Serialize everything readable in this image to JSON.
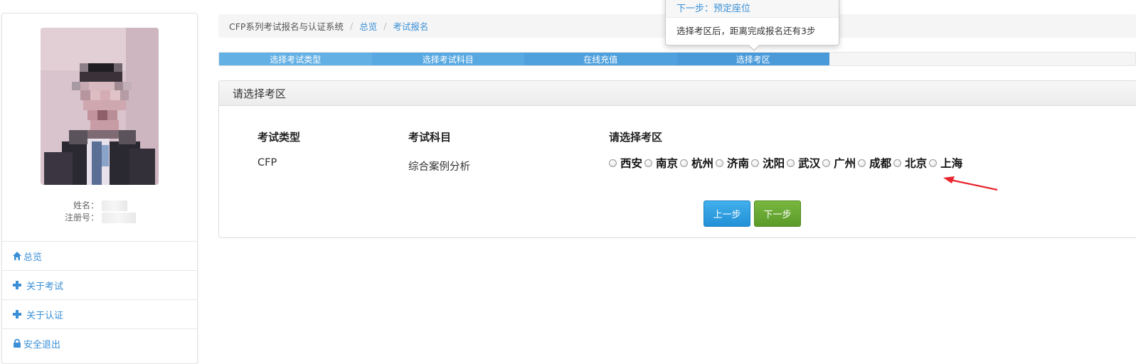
{
  "sidebar": {
    "name_label": "姓名：",
    "reg_label": "注册号：",
    "nav": [
      {
        "label": "总览",
        "icon": "home-icon"
      },
      {
        "label": "关于考试",
        "icon": "plus-icon"
      },
      {
        "label": "关于认证",
        "icon": "plus-icon"
      },
      {
        "label": "安全退出",
        "icon": "lock-icon"
      }
    ]
  },
  "breadcrumb": {
    "home": "CFP系列考试报名与认证系统",
    "sep": "/",
    "items": [
      "总览",
      "考试报名"
    ]
  },
  "progress": {
    "steps": [
      "选择考试类型",
      "选择考试科目",
      "在线充值",
      "选择考区"
    ],
    "completed_steps": 4,
    "total_fraction": 0.665
  },
  "popover": {
    "title": "下一步：预定座位",
    "body": "选择考区后，距离完成报名还有3步"
  },
  "panel": {
    "heading": "请选择考区",
    "columns": [
      "考试类型",
      "考试科目",
      "请选择考区"
    ],
    "exam_type": "CFP",
    "exam_subject": "综合案例分析",
    "regions": [
      "西安",
      "南京",
      "杭州",
      "济南",
      "沈阳",
      "武汉",
      "广州",
      "成都",
      "北京",
      "上海"
    ],
    "prev_button": "上一步",
    "next_button": "下一步"
  },
  "colors": {
    "link": "#3a8fd6",
    "progress": "#4a9ada",
    "prev_button": "#2aa0e3",
    "next_button": "#67a832",
    "annotation_arrow": "#e8242c"
  }
}
